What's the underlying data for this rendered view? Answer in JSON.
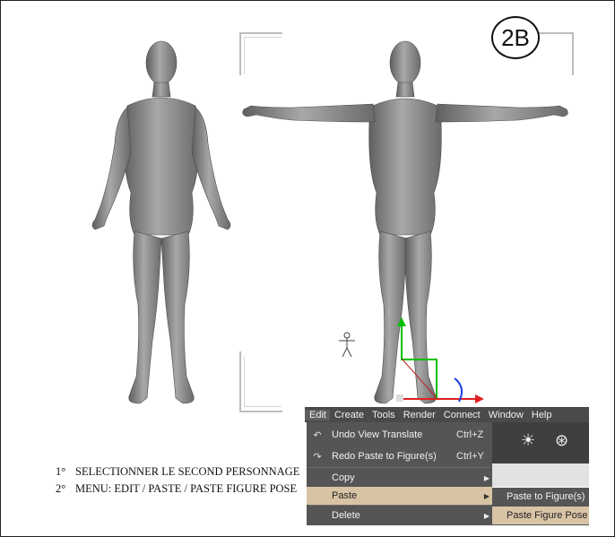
{
  "badge": {
    "label": "2B"
  },
  "instructions": [
    {
      "num": "1°",
      "text": "SELECTIONNER LE SECOND PERSONNAGE"
    },
    {
      "num": "2°",
      "text": "MENU: EDIT / PASTE / PASTE FIGURE POSE"
    }
  ],
  "menubar": [
    {
      "label": "Edit",
      "underline": "E",
      "active": true
    },
    {
      "label": "Create",
      "underline": "C"
    },
    {
      "label": "Tools",
      "underline": "T"
    },
    {
      "label": "Render",
      "underline": "R"
    },
    {
      "label": "Connect",
      "underline": "C"
    },
    {
      "label": "Window",
      "underline": "W"
    },
    {
      "label": "Help",
      "underline": "H"
    }
  ],
  "edit_menu": {
    "undo": {
      "label": "Undo View Translate",
      "shortcut": "Ctrl+Z",
      "icon": "undo-icon"
    },
    "redo": {
      "label": "Redo Paste to Figure(s)",
      "shortcut": "Ctrl+Y",
      "icon": "redo-icon"
    },
    "copy": {
      "label": "Copy"
    },
    "paste": {
      "label": "Paste"
    },
    "delete": {
      "label": "Delete"
    }
  },
  "paste_submenu": {
    "paste_to_figures": "Paste to Figure(s)",
    "paste_figure_pose": "Paste Figure Pose"
  },
  "colors": {
    "menu_bg": "#4a4a4a",
    "dropdown_bg": "#555555",
    "highlight": "#d8c3a5",
    "figure_gray": "#8a8a8a"
  }
}
